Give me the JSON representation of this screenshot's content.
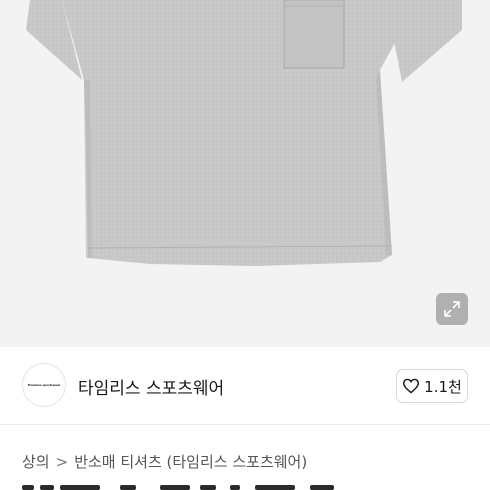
{
  "product_image": {
    "alt": "",
    "expand_icon": "expand-arrows-icon",
    "background": "#f3f3f3",
    "shirt_color": "#c9c9c9"
  },
  "store": {
    "logo_text": "Timeless sportswear",
    "name": "타임리스 스포츠웨어",
    "like_icon": "heart-outline-icon",
    "like_count": "1.1천"
  },
  "breadcrumb": {
    "items": [
      "상의",
      "반소매 티셔츠 (타임리스 스포츠웨어)"
    ],
    "separator": ">"
  }
}
